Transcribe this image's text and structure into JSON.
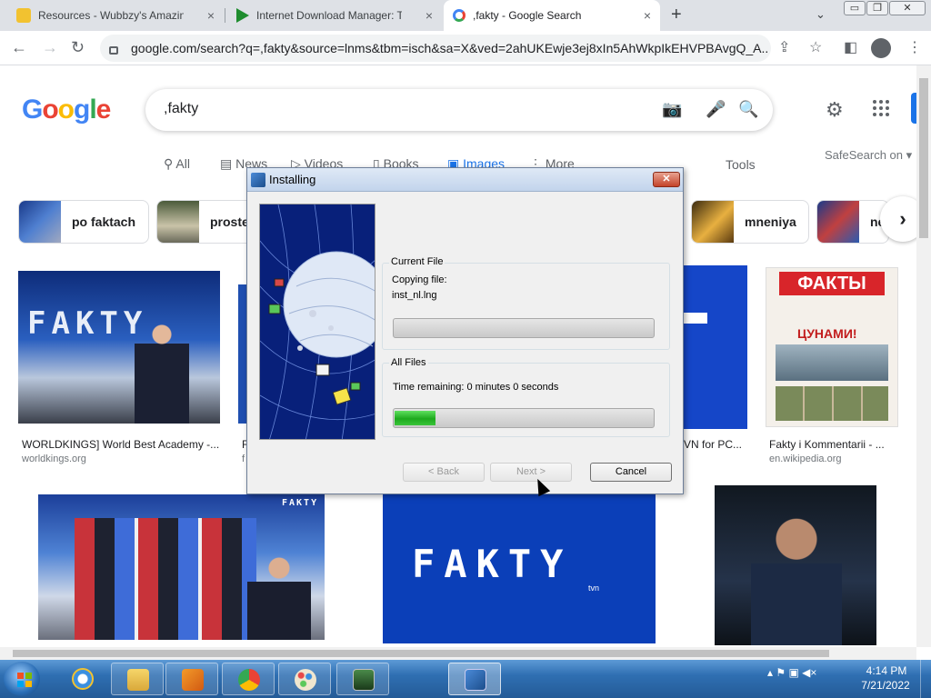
{
  "browser": {
    "tabs": [
      {
        "title": "Resources - Wubbzy's Amazing A",
        "icon": "wubbzy-favicon"
      },
      {
        "title": "Internet Download Manager: The",
        "icon": "idm-favicon"
      },
      {
        "title": ",fakty - Google Search",
        "icon": "google-favicon"
      }
    ],
    "new_tab_glyph": "+",
    "tab_search_glyph": "⌄",
    "close_glyph": "×",
    "window_controls": {
      "minimize": "▭",
      "maximize": "❐",
      "close": "✕"
    },
    "url": "google.com/search?q=,fakty&source=lnms&tbm=isch&sa=X&ved=2ahUKEwje3ej8xIn5AhWkpIkEHVPBAvgQ_A..."
  },
  "google": {
    "logo": [
      "G",
      "o",
      "o",
      "g",
      "l",
      "e"
    ],
    "query": ",fakty",
    "nav_tabs": [
      {
        "label": "All",
        "icon": "search-icon"
      },
      {
        "label": "News",
        "icon": "news-icon"
      },
      {
        "label": "Videos",
        "icon": "video-icon"
      },
      {
        "label": "Books",
        "icon": "book-icon"
      },
      {
        "label": "Images",
        "icon": "image-icon",
        "active": true
      },
      {
        "label": "More",
        "icon": "more-vert-icon"
      }
    ],
    "tools": "Tools",
    "safesearch": "SafeSearch on ▾",
    "chips": [
      {
        "label": "po faktach"
      },
      {
        "label": "proste"
      },
      {
        "label": "mneniya"
      },
      {
        "label": "ne"
      }
    ],
    "results": [
      {
        "title": "WORLDKINGS] World Best Academy -...",
        "site": "worldkings.org"
      },
      {
        "title": "F",
        "site": "f"
      },
      {
        "title": "VN for PC...",
        "site": ""
      },
      {
        "title": "Fakty i Kommentarii - ...",
        "site": "en.wikipedia.org"
      }
    ],
    "image_texts": {
      "fakty_logo": "FAKTY",
      "fakty_logo_small": "FAKTY",
      "tvn_mark": "tvn",
      "newspaper_masthead": "ФАКТЫ",
      "newspaper_headline": "ЦУНАМИ!"
    },
    "accent": "#1a73e8"
  },
  "dialog": {
    "title": "Installing",
    "close_glyph": "✕",
    "current_file_group": "Current File",
    "copying_label": "Copying file:",
    "filename": "inst_nl.lng",
    "current_progress": 0,
    "all_files_group": "All Files",
    "time_remaining": "Time remaining: 0 minutes 0 seconds",
    "all_progress": 0.16,
    "buttons": {
      "back": "< Back",
      "next": "Next >",
      "cancel": "Cancel"
    }
  },
  "taskbar": {
    "apps": [
      {
        "icon": "ie-icon"
      },
      {
        "icon": "explorer-icon"
      },
      {
        "icon": "media-player-icon"
      },
      {
        "icon": "chrome-icon"
      },
      {
        "icon": "paint-icon"
      },
      {
        "icon": "terminal-icon"
      },
      {
        "icon": "installer-icon",
        "active": true
      }
    ],
    "tray_icons": "▴  ⚑  ▣  ◀×",
    "time": "4:14 PM",
    "date": "7/21/2022"
  }
}
